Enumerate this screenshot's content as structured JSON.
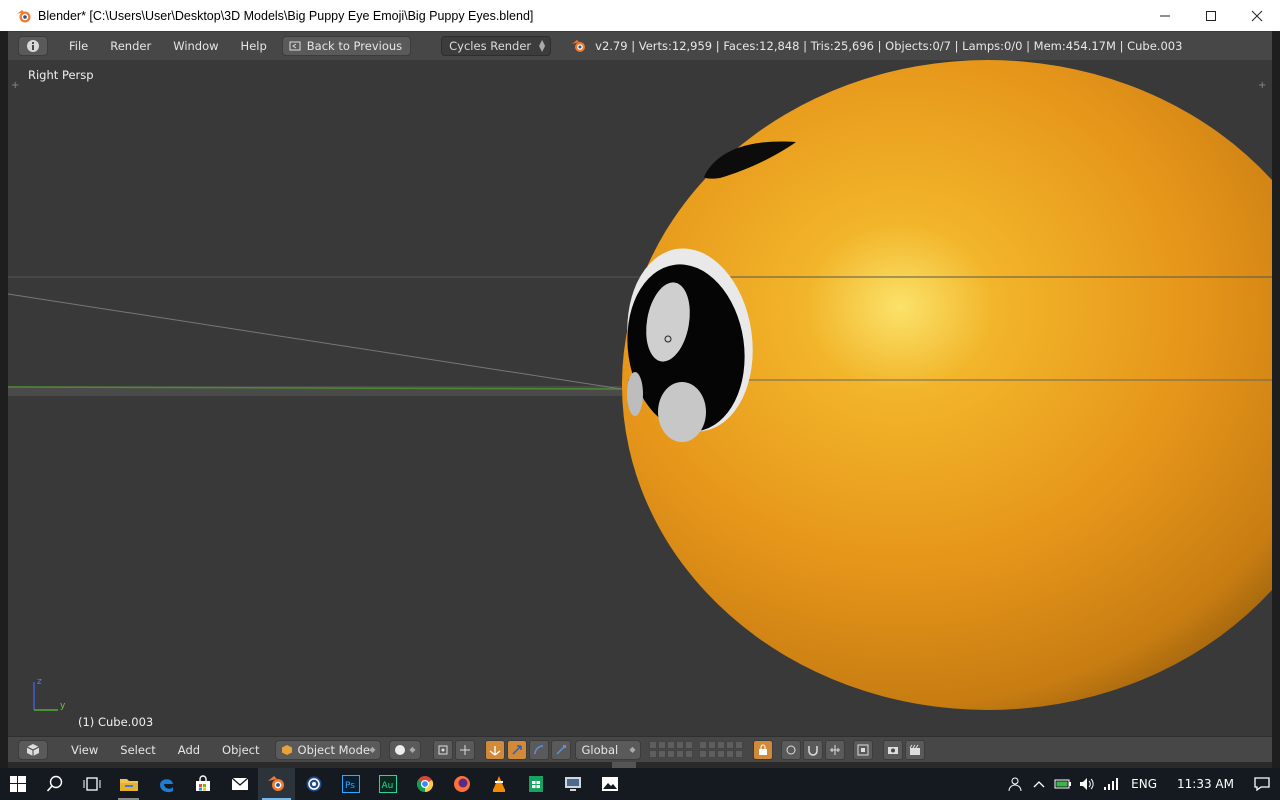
{
  "window": {
    "title": "Blender* [C:\\Users\\User\\Desktop\\3D Models\\Big Puppy Eye Emoji\\Big Puppy Eyes.blend]",
    "minimize_icon": "minimize-icon",
    "maximize_icon": "maximize-icon",
    "close_icon": "close-icon"
  },
  "info_header": {
    "menus": [
      "File",
      "Render",
      "Window",
      "Help"
    ],
    "back_button": "Back to Previous",
    "render_engine": "Cycles Render",
    "stats": "v2.79 | Verts:12,959 | Faces:12,848 | Tris:25,696 | Objects:0/7 | Lamps:0/0 | Mem:454.17M | Cube.003"
  },
  "viewport": {
    "view_name": "Right Persp",
    "active_object": "(1) Cube.003",
    "axis_z": "z",
    "axis_y": "y"
  },
  "view_header": {
    "menus": [
      "View",
      "Select",
      "Add",
      "Object"
    ],
    "mode": "Object Mode",
    "orientation": "Global"
  },
  "taskbar": {
    "apps": [
      "start-icon",
      "search-icon",
      "task-view-icon",
      "file-explorer-icon",
      "edge-icon",
      "store-icon",
      "mail-icon",
      "blender-icon",
      "cinema4d-icon",
      "photoshop-icon",
      "audition-icon",
      "chrome-icon",
      "firefox-icon",
      "vlc-icon",
      "sheets-icon",
      "remote-desktop-icon",
      "photos-icon"
    ],
    "photoshop_label": "Ps",
    "audition_label": "Au",
    "language": "ENG",
    "time": "11:33 AM"
  },
  "colors": {
    "emoji_orange": "#e89a1a",
    "viewport_bg": "#393939",
    "header_bg": "#474747",
    "taskbar_bg": "#151a21"
  }
}
